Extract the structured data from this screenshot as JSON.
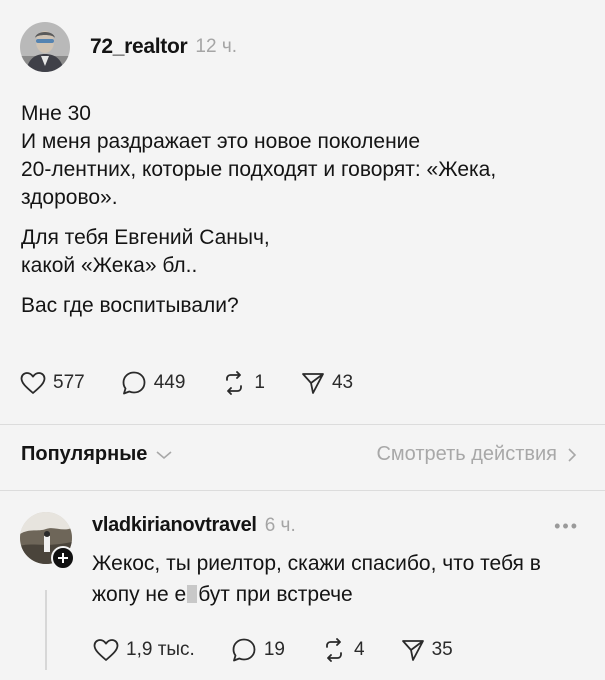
{
  "post": {
    "username": "72_realtor",
    "time": "12 ч.",
    "lines_p1": [
      "Мне 30",
      "И меня раздражает это новое поколение",
      "20-лентних, которые подходят и говорят: «Жека,",
      "здорово»."
    ],
    "lines_p2": [
      "Для тебя Евгений Саныч,",
      "какой «Жека» бл.."
    ],
    "lines_p3": [
      "Вас где воспитывали?"
    ],
    "likes": "577",
    "comments": "449",
    "reposts": "1",
    "shares": "43"
  },
  "sort_bar": {
    "sort_label": "Популярные",
    "activity_label": "Смотреть действия"
  },
  "reply": {
    "username": "vladkirianovtravel",
    "time": "6 ч.",
    "more": "•••",
    "text_line1": "Жекос, ты риелтор, скажи спасибо, что тебя в",
    "text_line2_a": "жопу не е",
    "text_line2_b": "бут при встрече",
    "likes": "1,9 тыс.",
    "comments": "19",
    "reposts": "4",
    "shares": "35"
  },
  "colors": {
    "background": "#f4f4f4",
    "text": "#141414",
    "muted": "#a5a5a5",
    "divider": "#dcdcdc"
  }
}
